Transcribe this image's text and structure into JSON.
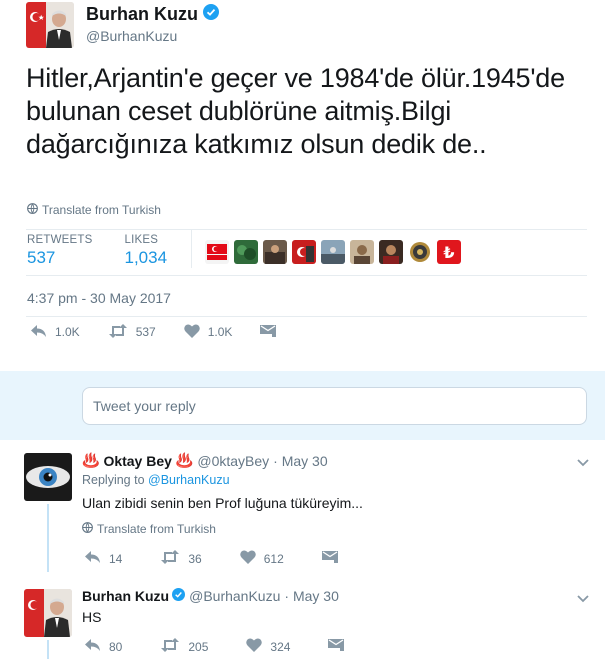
{
  "tweet": {
    "author_name": "Burhan Kuzu",
    "author_handle": "@BurhanKuzu",
    "text": "Hitler,Arjantin'e geçer ve 1984'de ölür.1945'de bulunan ceset dublörüne aitmiş.Bilgi dağarcığınıza katkımız olsun dedik de..",
    "translate_label": "Translate from Turkish",
    "stats": {
      "retweets_label": "RETWEETS",
      "retweets_value": "537",
      "likes_label": "LIKES",
      "likes_value": "1,034"
    },
    "timestamp": "4:37 pm - 30 May 2017",
    "actions": {
      "reply_count": "1.0K",
      "retweet_count": "537",
      "like_count": "1.0K"
    },
    "likers": [
      "flag-avatar",
      "photo-avatar",
      "photo-avatar",
      "flag-avatar",
      "photo-avatar",
      "photo-avatar",
      "photo-avatar",
      "emblem-avatar",
      "lira-avatar"
    ]
  },
  "reply_box": {
    "placeholder": "Tweet your reply"
  },
  "replies": [
    {
      "name_prefix": "♨️",
      "name": "Oktay Bey",
      "name_suffix": "♨️",
      "handle": "@0ktayBey",
      "time": "· May 30",
      "replying_to_label": "Replying to",
      "replying_to_handle": "@BurhanKuzu",
      "text": "Ulan zibidi senin ben Prof luğuna tüküreyim...",
      "translate_label": "Translate from Turkish",
      "reply_count": "14",
      "retweet_count": "36",
      "like_count": "612"
    },
    {
      "name": "Burhan Kuzu",
      "handle": "@BurhanKuzu",
      "time": "· May 30",
      "text": "HS",
      "reply_count": "80",
      "retweet_count": "205",
      "like_count": "324"
    }
  ],
  "colors": {
    "accent": "#1b95e0",
    "muted": "#657786",
    "reply_area_bg": "#e8f5fd",
    "thread_line": "#c4e2f6"
  }
}
